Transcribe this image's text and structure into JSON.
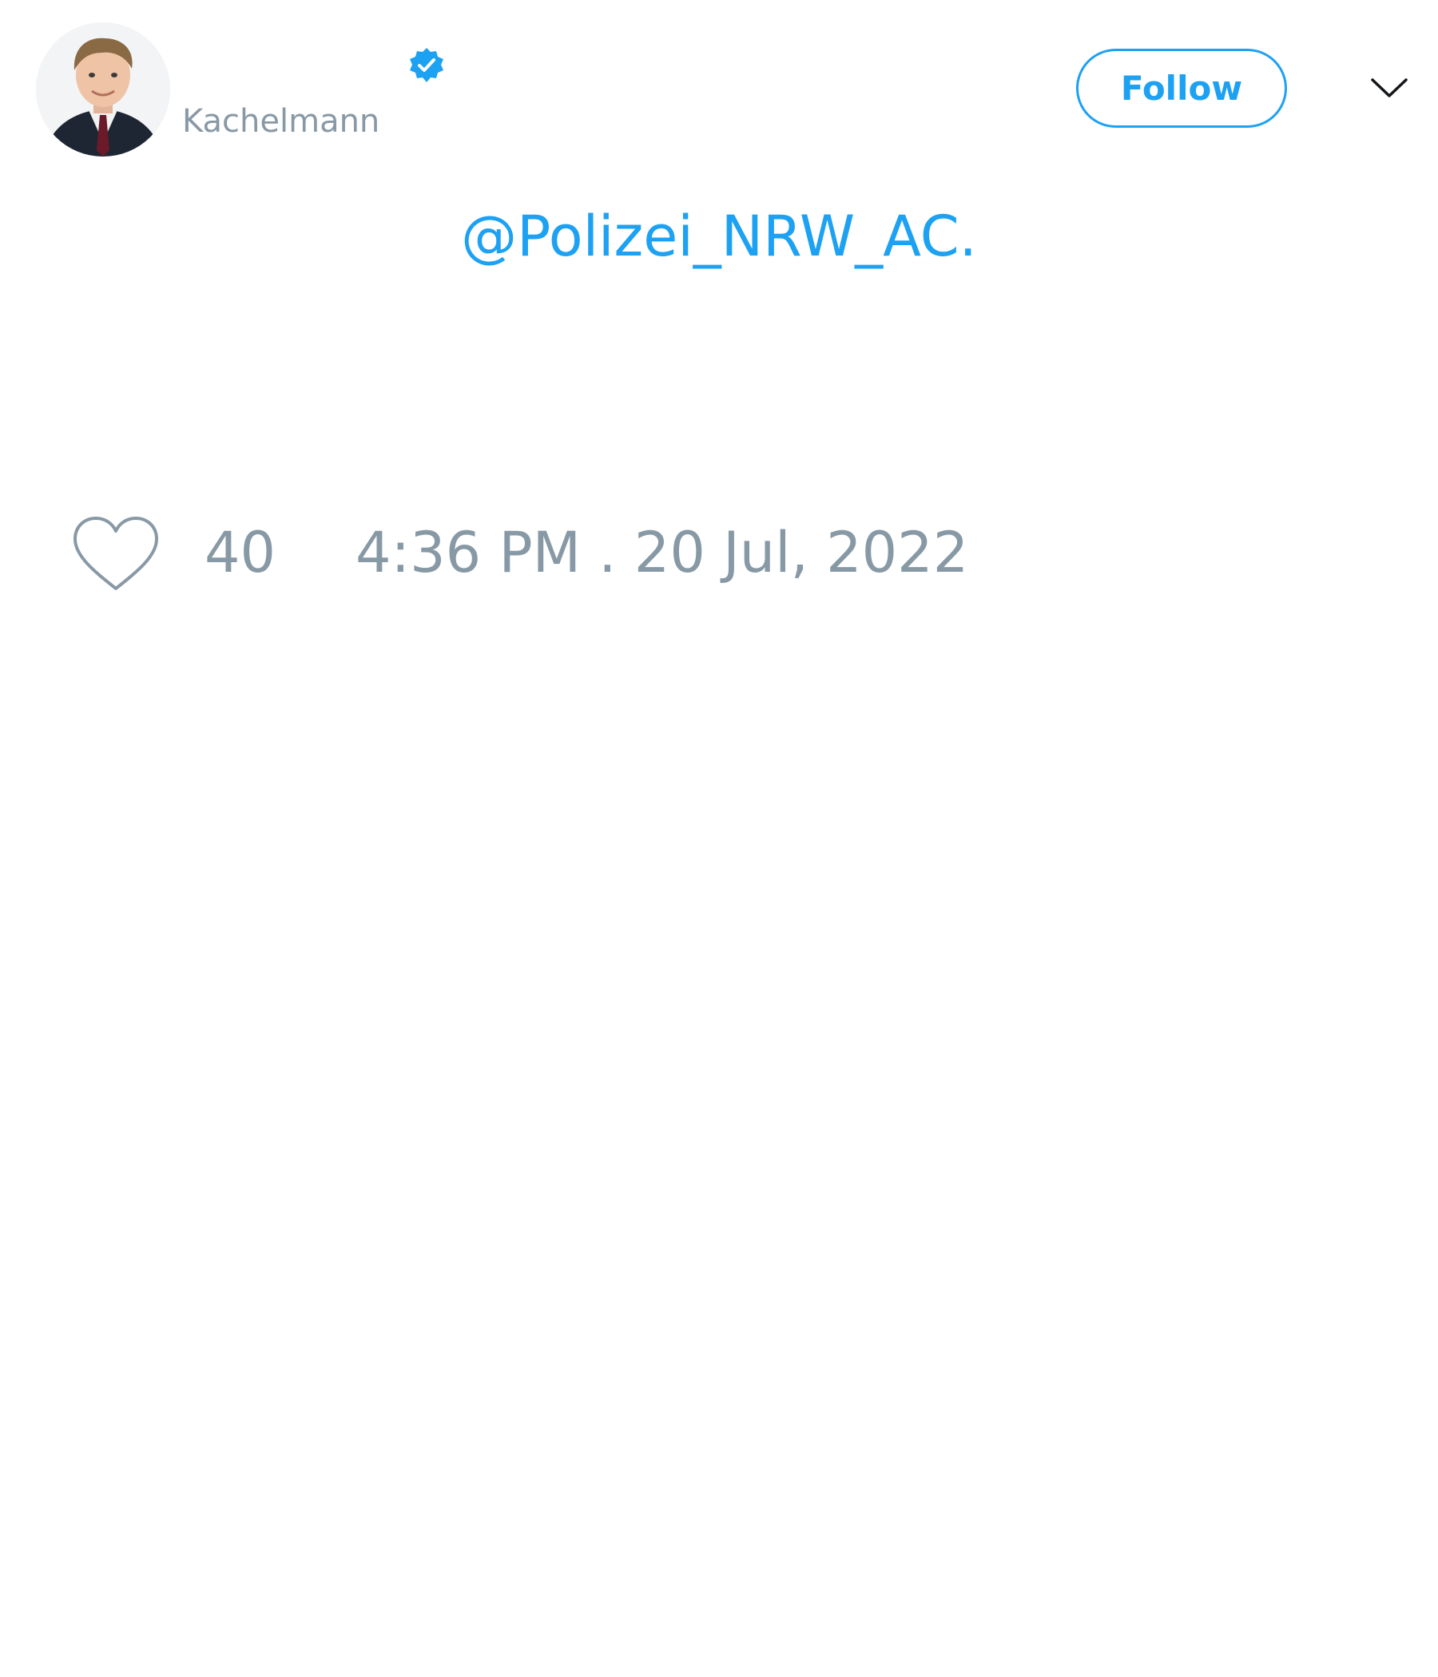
{
  "author": {
    "handle": "Kachelmann",
    "verified": true,
    "avatar_icon": "profile-photo"
  },
  "follow_button": {
    "label": "Follow"
  },
  "menu": {
    "icon": "chevron-down-icon"
  },
  "tweet": {
    "text": "@Polizei_NRW_AC."
  },
  "engagement": {
    "like_icon": "heart-icon",
    "like_count": "40",
    "timestamp": "4:36 PM . 20 Jul, 2022"
  },
  "colors": {
    "accent": "#1da1f2",
    "secondary_text": "#8899a6",
    "background": "#ffffff"
  }
}
